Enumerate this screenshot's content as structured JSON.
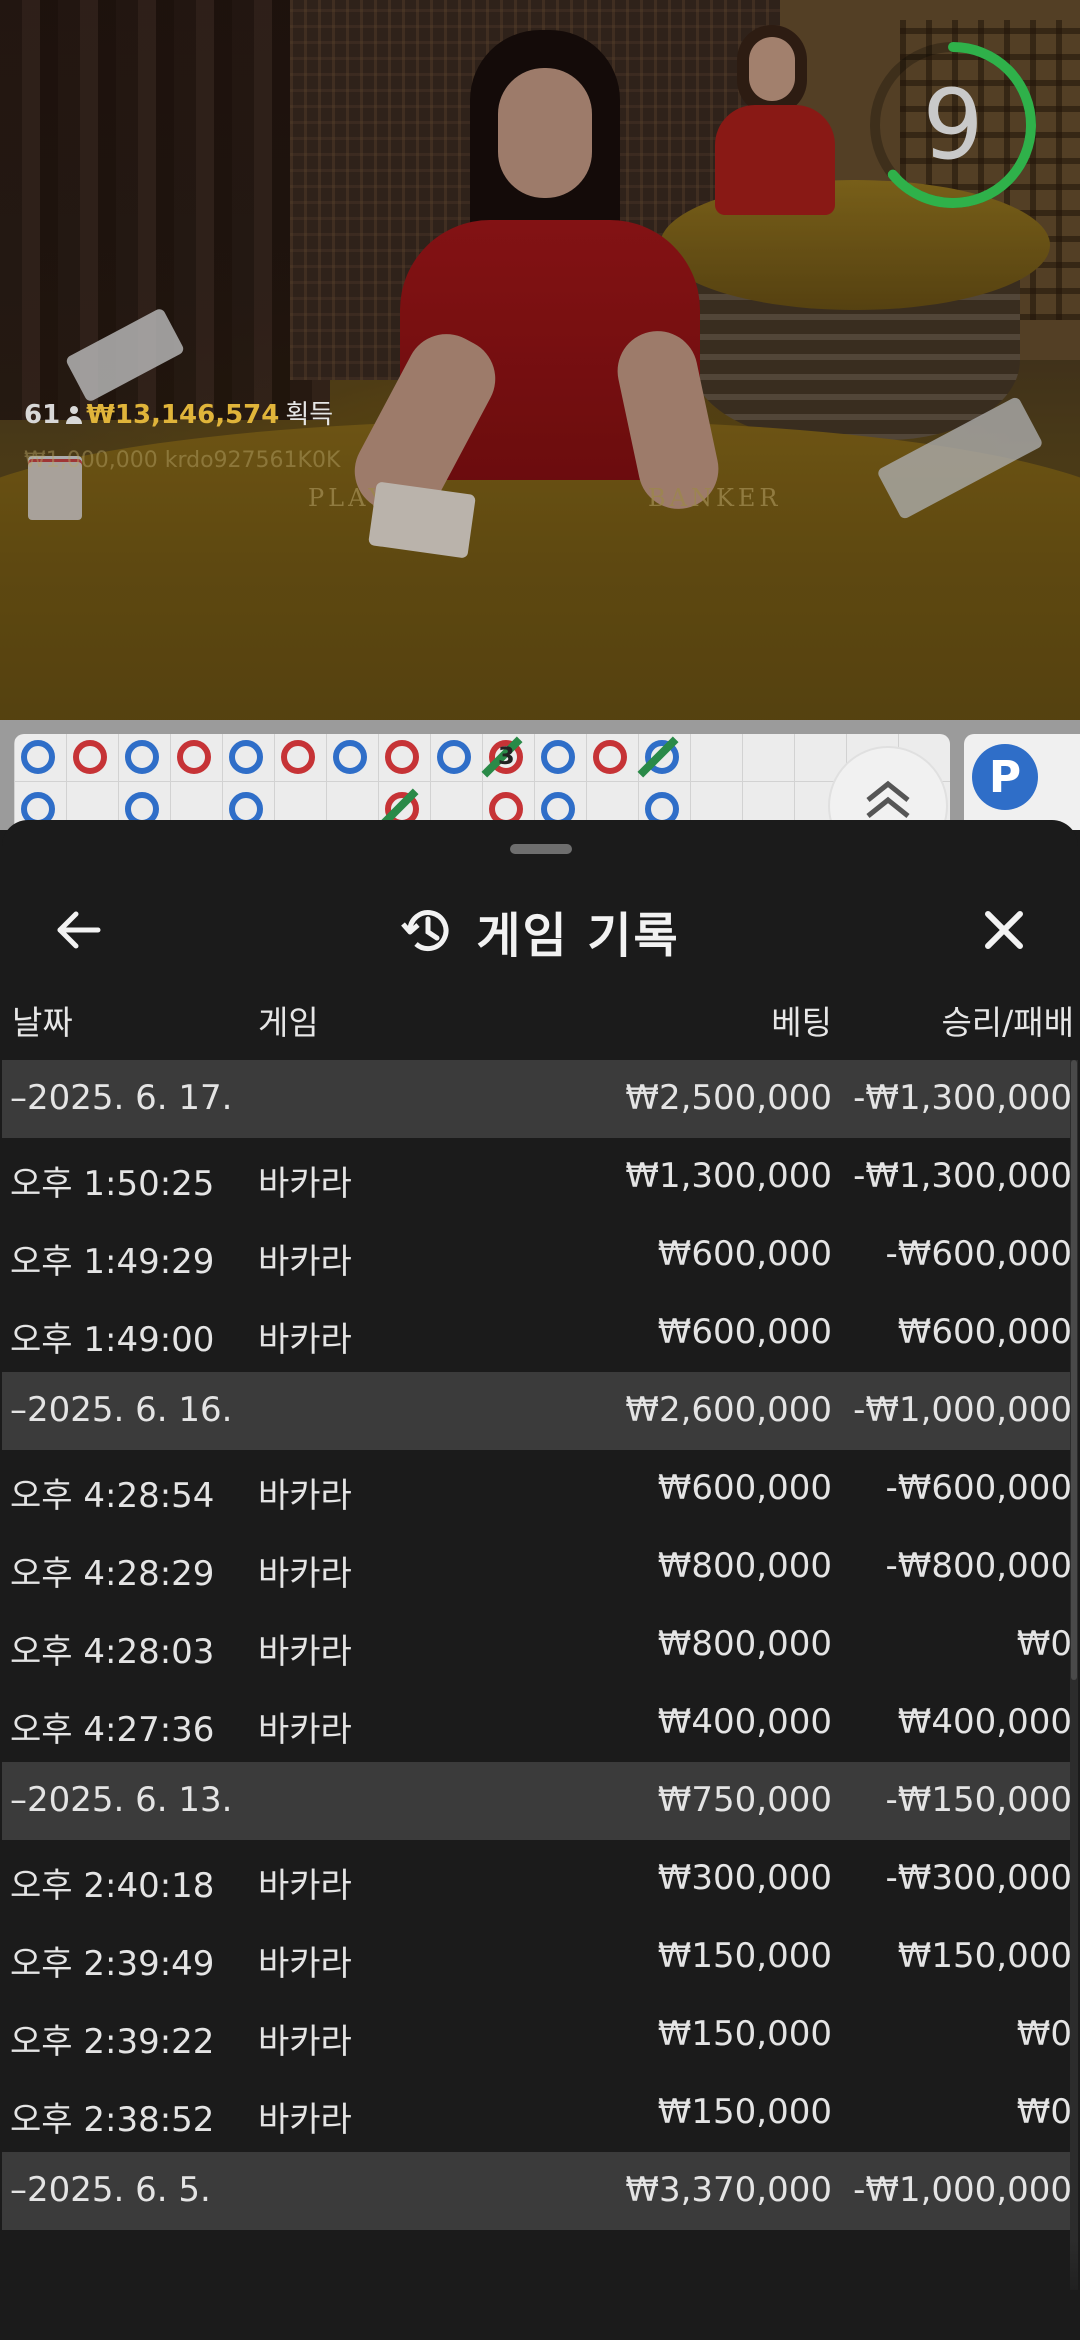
{
  "video": {
    "winners_count": "61",
    "winners_amount": "₩13,146,574",
    "winners_suffix": "획득",
    "ticker": "₩1,000,000 krdo927561K0K",
    "timer": "9",
    "timer_progress": 0.64,
    "felt_player": "PLAYER",
    "felt_banker": "BANKER"
  },
  "road": {
    "count_label": "3",
    "p_chip": "P"
  },
  "sheet": {
    "title": "게임 기록",
    "back_icon": "arrow-left-icon",
    "history_icon": "history-icon",
    "close_icon": "close-icon",
    "headers": {
      "date": "날짜",
      "game": "게임",
      "bet": "베팅",
      "result": "승리/패배"
    },
    "groups": [
      {
        "date": "–2025. 6. 17.",
        "bet": "₩2,500,000",
        "result": "-₩1,300,000",
        "rows": [
          {
            "time": "오후 1:50:25",
            "game": "바카라",
            "bet": "₩1,300,000",
            "result": "-₩1,300,000"
          },
          {
            "time": "오후 1:49:29",
            "game": "바카라",
            "bet": "₩600,000",
            "result": "-₩600,000"
          },
          {
            "time": "오후 1:49:00",
            "game": "바카라",
            "bet": "₩600,000",
            "result": "₩600,000"
          }
        ]
      },
      {
        "date": "–2025. 6. 16.",
        "bet": "₩2,600,000",
        "result": "-₩1,000,000",
        "rows": [
          {
            "time": "오후 4:28:54",
            "game": "바카라",
            "bet": "₩600,000",
            "result": "-₩600,000"
          },
          {
            "time": "오후 4:28:29",
            "game": "바카라",
            "bet": "₩800,000",
            "result": "-₩800,000"
          },
          {
            "time": "오후 4:28:03",
            "game": "바카라",
            "bet": "₩800,000",
            "result": "₩0"
          },
          {
            "time": "오후 4:27:36",
            "game": "바카라",
            "bet": "₩400,000",
            "result": "₩400,000"
          }
        ]
      },
      {
        "date": "–2025. 6. 13.",
        "bet": "₩750,000",
        "result": "-₩150,000",
        "rows": [
          {
            "time": "오후 2:40:18",
            "game": "바카라",
            "bet": "₩300,000",
            "result": "-₩300,000"
          },
          {
            "time": "오후 2:39:49",
            "game": "바카라",
            "bet": "₩150,000",
            "result": "₩150,000"
          },
          {
            "time": "오후 2:39:22",
            "game": "바카라",
            "bet": "₩150,000",
            "result": "₩0"
          },
          {
            "time": "오후 2:38:52",
            "game": "바카라",
            "bet": "₩150,000",
            "result": "₩0"
          }
        ]
      },
      {
        "date": "–2025. 6. 5.",
        "bet": "₩3,370,000",
        "result": "-₩1,000,000",
        "rows": []
      }
    ]
  },
  "colors": {
    "accent_gold": "#e0b43a",
    "timer_green": "#2fb14a",
    "banker_red": "#c63336",
    "player_blue": "#2f6ec8",
    "sheet_bg": "#1b1b1b",
    "date_row_bg": "#3b3b3b"
  }
}
